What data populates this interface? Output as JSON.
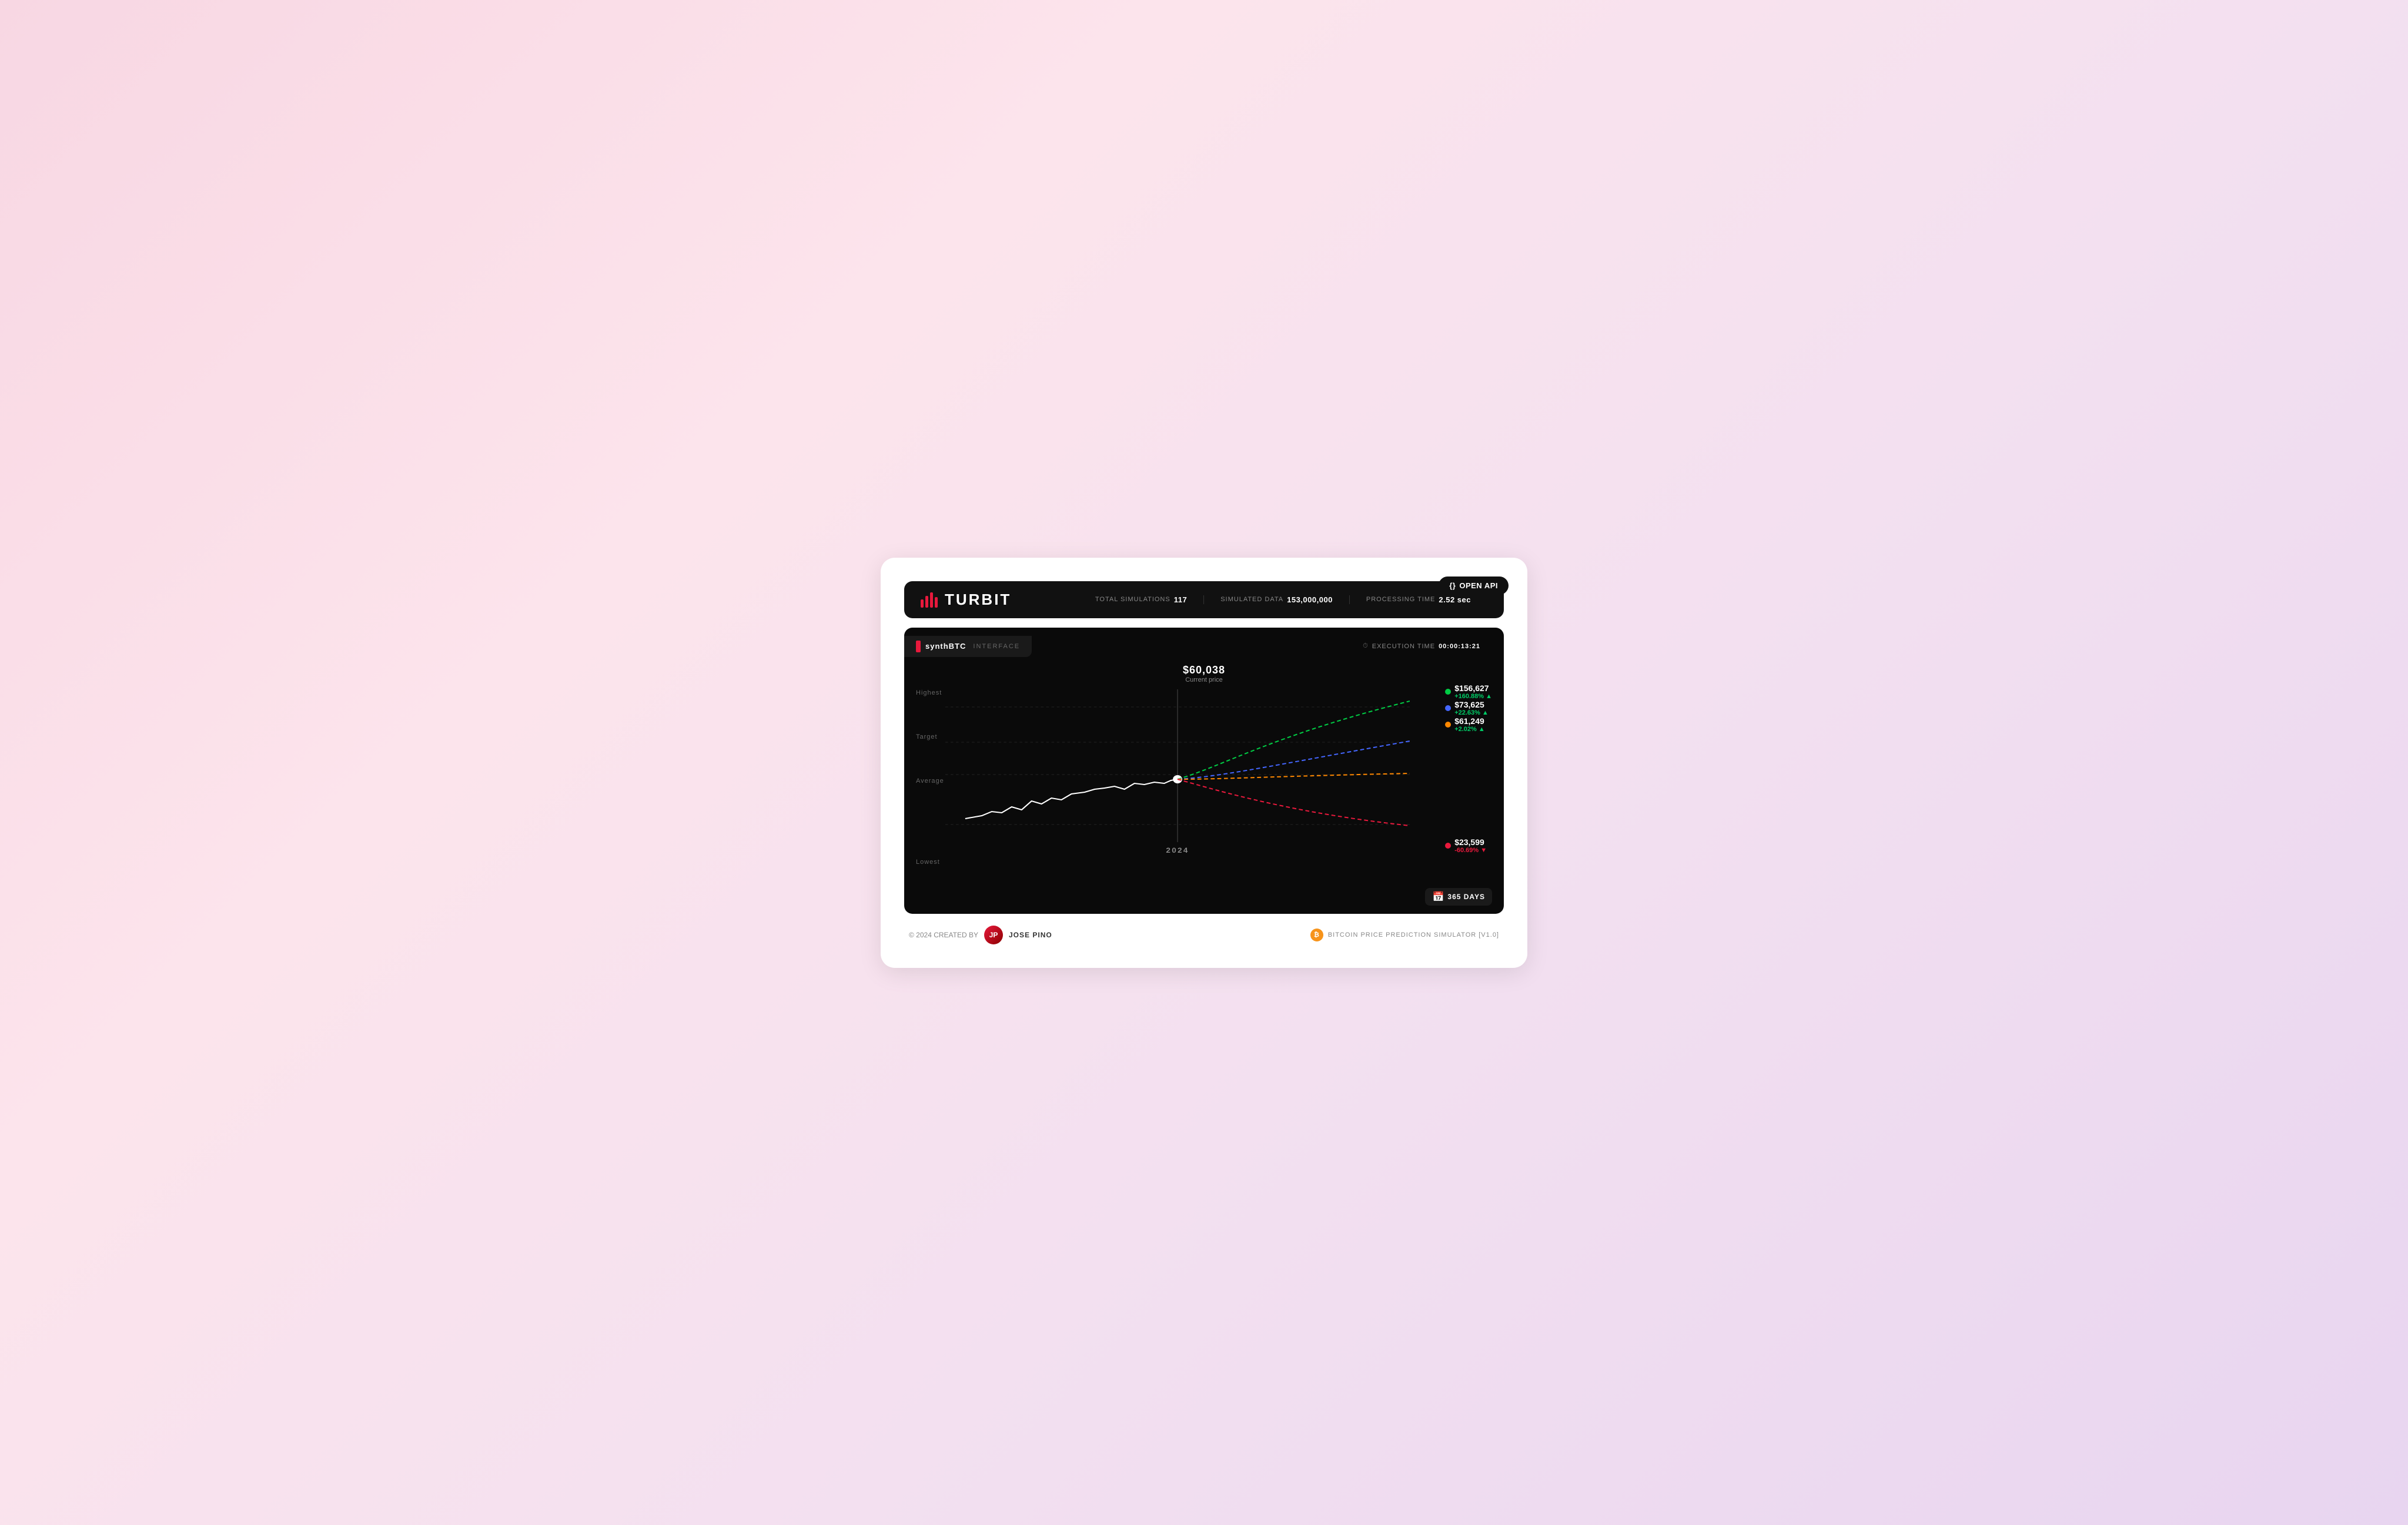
{
  "app": {
    "title": "TURBIT",
    "background_color": "#f8d5e8"
  },
  "open_api_button": {
    "label": "OPEN API",
    "icon": "{}"
  },
  "header": {
    "logo_text": "TURBIT",
    "stats": [
      {
        "label": "TOTAL SIMULATIONS",
        "value": "117"
      },
      {
        "label": "SIMULATED DATA",
        "value": "153,000,000"
      },
      {
        "label": "PROCESSING TIME",
        "value": "2.52 sec"
      }
    ]
  },
  "chart": {
    "title": "synthBTC",
    "subtitle": "INTERFACE",
    "current_price": "$60,038",
    "current_price_label": "Current price",
    "execution_label": "EXECUTION TIME",
    "execution_value": "00:00:13:21",
    "year_label": "2024",
    "days_badge": "365 DAYS",
    "y_labels": [
      "Highest",
      "Target",
      "Average",
      "",
      "Lowest"
    ],
    "predictions": [
      {
        "id": "highest",
        "value": "$156,627",
        "change": "+160.88%",
        "direction": "up",
        "color": "#00cc44"
      },
      {
        "id": "target",
        "value": "$73,625",
        "change": "+22.63%",
        "direction": "up",
        "color": "#4466ff"
      },
      {
        "id": "average",
        "value": "$61,249",
        "change": "+2.02%",
        "direction": "up",
        "color": "#ff8800"
      },
      {
        "id": "lowest",
        "value": "$23,599",
        "change": "-60.69%",
        "direction": "down",
        "color": "#e8193c"
      }
    ]
  },
  "footer": {
    "copyright": "© 2024 CREATED BY",
    "creator": "JOSE PINO",
    "product_label": "BITCOIN PRICE PREDICTION SIMULATOR [V1.0]"
  }
}
